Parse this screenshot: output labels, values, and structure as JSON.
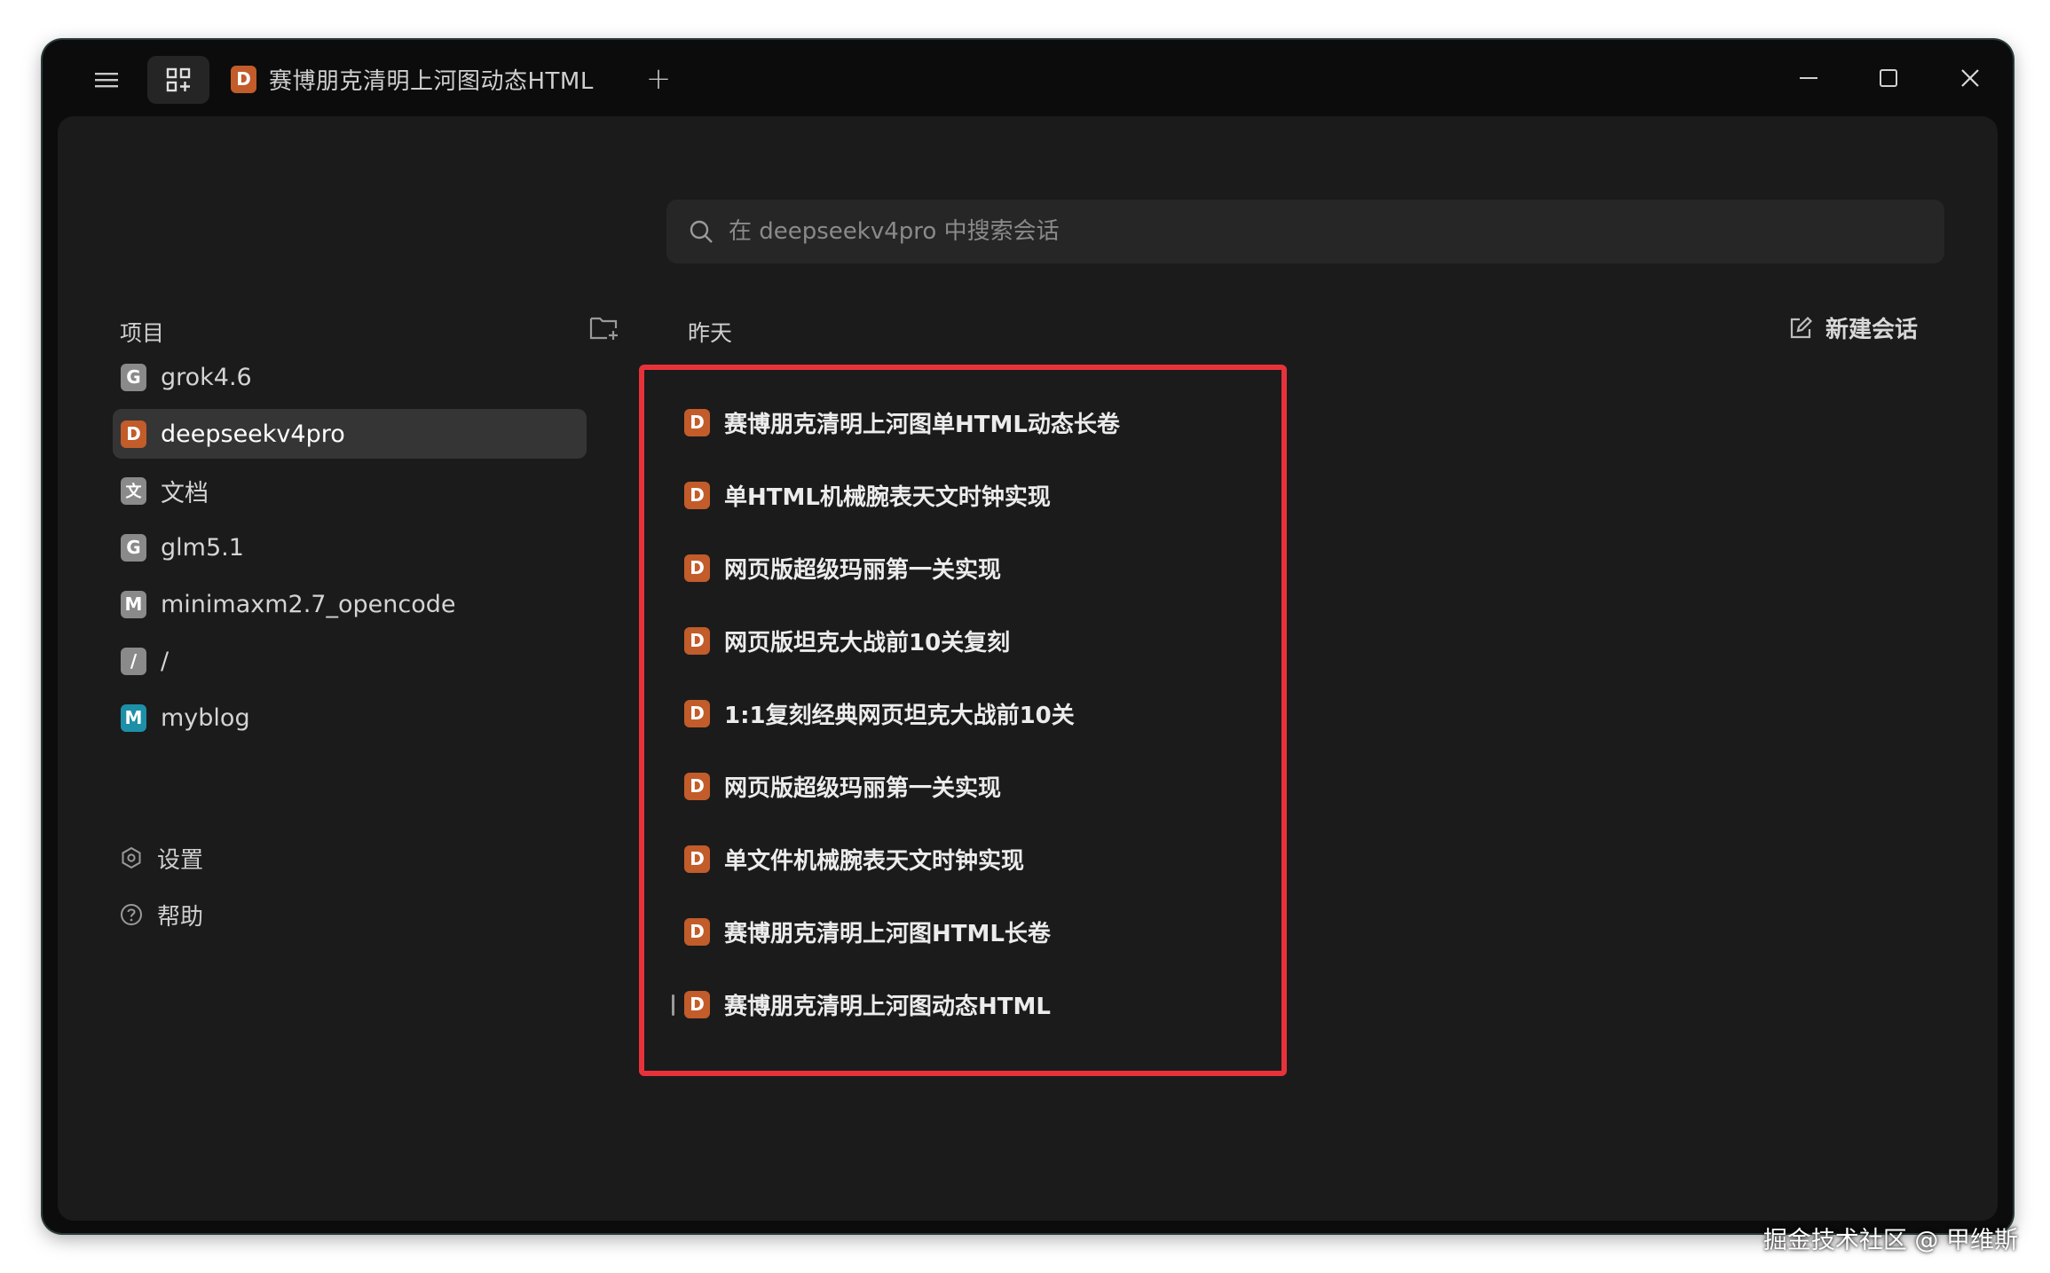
{
  "titlebar": {
    "active_tab": {
      "badge": "D",
      "title": "赛博朋克清明上河图动态HTML"
    },
    "new_tab_label": "+"
  },
  "search": {
    "placeholder": "在 deepseekv4pro 中搜索会话"
  },
  "sidebar": {
    "header": "项目",
    "projects": [
      {
        "badge": "G",
        "label": "grok4.6"
      },
      {
        "badge": "D",
        "label": "deepseekv4pro",
        "active": true
      },
      {
        "badge": "文",
        "label": "文档"
      },
      {
        "badge": "G",
        "label": "glm5.1"
      },
      {
        "badge": "M",
        "label": "minimaxm2.7_opencode"
      },
      {
        "badge": "/",
        "label": "/"
      },
      {
        "badge": "M",
        "label": "myblog"
      }
    ],
    "footer": [
      {
        "icon": "gear-icon",
        "label": "设置"
      },
      {
        "icon": "help-icon",
        "label": "帮助"
      }
    ]
  },
  "main": {
    "section_label": "昨天",
    "new_chat_label": "新建会话",
    "conversations": [
      {
        "badge": "D",
        "title": "赛博朋克清明上河图单HTML动态长卷"
      },
      {
        "badge": "D",
        "title": "单HTML机械腕表天文时钟实现"
      },
      {
        "badge": "D",
        "title": "网页版超级玛丽第一关实现"
      },
      {
        "badge": "D",
        "title": "网页版坦克大战前10关复刻"
      },
      {
        "badge": "D",
        "title": "1:1复刻经典网页坦克大战前10关"
      },
      {
        "badge": "D",
        "title": "网页版超级玛丽第一关实现"
      },
      {
        "badge": "D",
        "title": "单文件机械腕表天文时钟实现"
      },
      {
        "badge": "D",
        "title": "赛博朋克清明上河图HTML长卷"
      },
      {
        "badge": "D",
        "title": "赛博朋克清明上河图动态HTML"
      }
    ]
  },
  "watermark": "掘金技术社区 @ 甲维斯",
  "colors": {
    "badge_d": "#c25c2a",
    "badge_gray": "#8a8a8a",
    "badge_teal": "#1e8fa8",
    "highlight": "#e8323a",
    "panel_bg": "#1b1b1b",
    "window_bg": "#0c0c0c"
  }
}
